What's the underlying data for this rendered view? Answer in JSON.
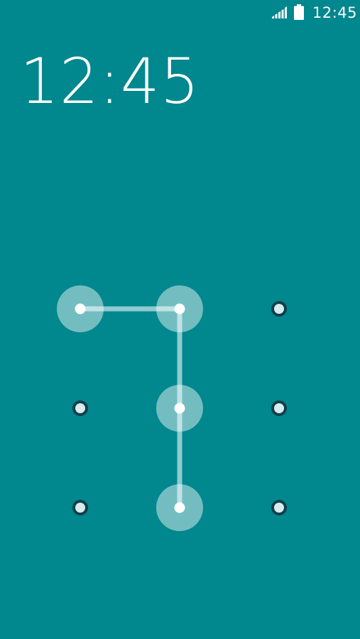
{
  "colors": {
    "background": "#01878e",
    "text": "#ffffff",
    "node_dot": "#123f4a",
    "node_inner": "#d6ecee",
    "node_halo": "#ffffff",
    "path_line": "#bfe2e4"
  },
  "status_bar": {
    "time": "12:45",
    "signal_icon": "signal-icon",
    "battery_icon": "battery-icon"
  },
  "lockscreen": {
    "clock": "12:45"
  },
  "pattern": {
    "rows": 3,
    "cols": 3,
    "selected_sequence": [
      0,
      1,
      4,
      7
    ]
  }
}
